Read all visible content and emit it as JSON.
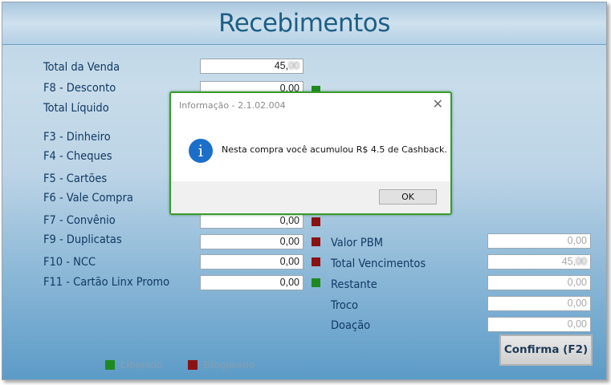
{
  "window": {
    "title": "Recebimentos"
  },
  "left_fields": [
    {
      "label": "Total da Venda",
      "value": "45,",
      "blurred_suffix": "00",
      "status": "none"
    },
    {
      "label": "F8 - Desconto",
      "value": "0,00",
      "status": "green"
    },
    {
      "label": "Total Líquido",
      "value": "",
      "status": "none"
    },
    {
      "label": "F3 - Dinheiro",
      "value": "",
      "status": "none"
    },
    {
      "label": "F4 - Cheques",
      "value": "",
      "status": "none"
    },
    {
      "label": "F5 - Cartões",
      "value": "",
      "status": "none"
    },
    {
      "label": "F6 - Vale Compra",
      "value": "",
      "status": "none"
    },
    {
      "label": "F7 - Convênio",
      "value": "0,00",
      "status": "red"
    },
    {
      "label": "F9 - Duplicatas",
      "value": "0,00",
      "status": "red"
    },
    {
      "label": "F10 - NCC",
      "value": "0,00",
      "status": "red"
    },
    {
      "label": "F11 - Cartão Linx Promo",
      "value": "0,00",
      "status": "green"
    }
  ],
  "right_fields": [
    {
      "label": "Valor PBM",
      "value": "0,00"
    },
    {
      "label": "Total Vencimentos",
      "value": "45,",
      "blurred_suffix": "00"
    },
    {
      "label": "Restante",
      "value": "0,00"
    },
    {
      "label": "Troco",
      "value": "0,00"
    },
    {
      "label": "Doação",
      "value": "0,00"
    }
  ],
  "legend": {
    "liberado": "Liberado",
    "bloqueado": "Bloqueado"
  },
  "confirm_button": "Confirma (F2)",
  "dialog": {
    "title": "Informação - 2.1.02.004",
    "close": "✕",
    "icon": "i",
    "message": "Nesta compra você acumulou R$ 4.5 de Cashback.",
    "ok": "OK"
  },
  "colors": {
    "status_green": "#1e8a1e",
    "status_red": "#8a1212",
    "dialog_border": "#3a9a2e",
    "info_icon": "#1b6fc9"
  }
}
